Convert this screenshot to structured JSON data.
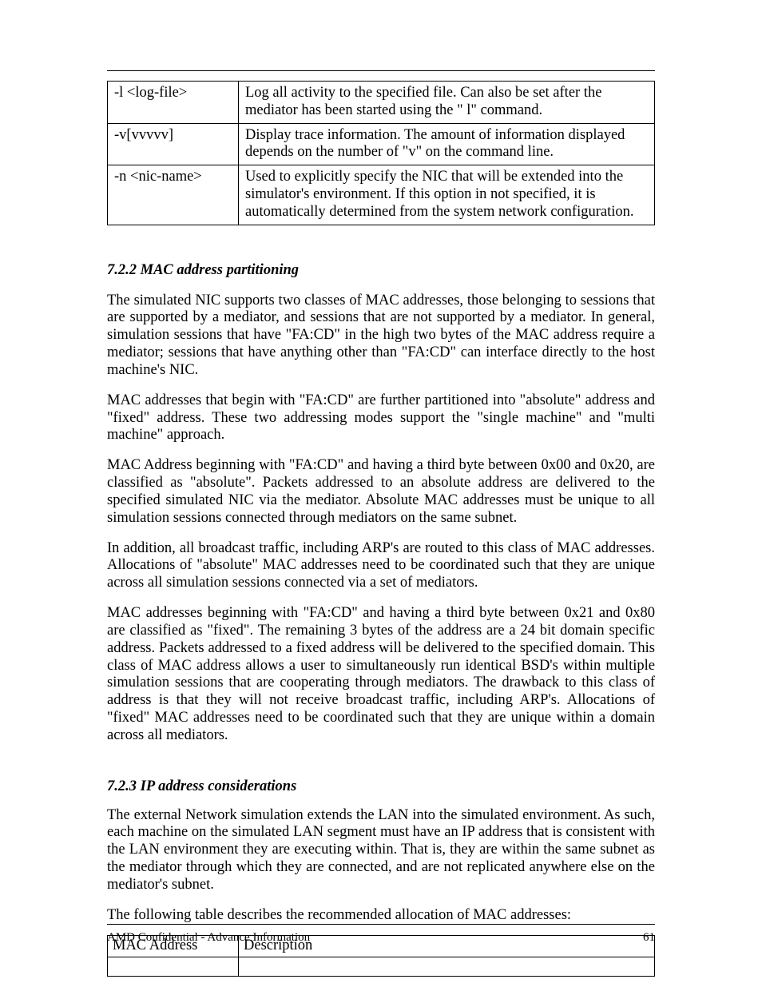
{
  "optionsTable": {
    "rows": [
      {
        "c1": "-l <log-file>",
        "c2": "Log all activity to the specified file. Can also be set after the mediator has been started using the \" l\" command."
      },
      {
        "c1": "-v[vvvvv]",
        "c2": "Display trace information. The amount of information displayed depends on the number of \"v\" on the command line."
      },
      {
        "c1": "-n <nic-name>",
        "c2": "Used to explicitly specify the NIC that will be extended into the simulator's environment. If this option in not specified, it is automatically determined from the system network configuration."
      }
    ]
  },
  "sections": {
    "s1": {
      "head": "7.2.2 MAC address partitioning",
      "p1": "The simulated NIC supports two classes of MAC addresses, those belonging to sessions that are supported by a mediator, and sessions that are not supported by a mediator. In general, simulation sessions that have \"FA:CD\" in the high two bytes of the MAC address require a mediator; sessions that have anything other than \"FA:CD\" can interface directly to the host machine's NIC.",
      "p2": "MAC addresses that begin with \"FA:CD\" are further partitioned into \"absolute\" address and \"fixed\" address. These two addressing modes support the \"single machine\" and \"multi machine\" approach.",
      "p3": "MAC Address beginning with \"FA:CD\" and having a third byte between 0x00 and 0x20, are classified as \"absolute\". Packets addressed to an absolute address are delivered to the specified simulated NIC via the mediator. Absolute MAC addresses must be unique to all simulation sessions connected through mediators on the same subnet.",
      "p4": "In addition, all broadcast traffic, including ARP's are routed to this class of MAC addresses. Allocations of \"absolute\" MAC addresses need to be coordinated such that they are unique across all simulation sessions connected via a set of mediators.",
      "p5": "MAC addresses beginning with \"FA:CD\" and having a third byte between 0x21 and 0x80 are classified as \"fixed\". The remaining 3 bytes of the address are a 24 bit domain specific address. Packets addressed to a fixed address will be delivered to the specified domain. This class of MAC address allows a user to simultaneously run identical BSD's within multiple simulation sessions that are cooperating through mediators. The drawback to this class of address is that they will not receive broadcast traffic, including ARP's. Allocations of \"fixed\" MAC addresses need to be coordinated such that they are unique within a domain across all mediators."
    },
    "s2": {
      "head": "7.2.3 IP address considerations",
      "p1": "The external Network simulation extends the LAN into the simulated environment. As such, each machine on the simulated LAN segment must have an IP address that is consistent with the LAN environment they are executing within. That is, they are within the same subnet as the mediator through which they are connected, and are not replicated anywhere else on the mediator's subnet.",
      "p2": "The following table describes the recommended allocation of MAC addresses:"
    }
  },
  "macsTable": {
    "rows": [
      {
        "c1": "MAC Address",
        "c2": "Description"
      },
      {
        "c1": "",
        "c2": ""
      }
    ]
  },
  "footer": {
    "left": "AMD Confidential - Advance Information",
    "right": "61"
  }
}
